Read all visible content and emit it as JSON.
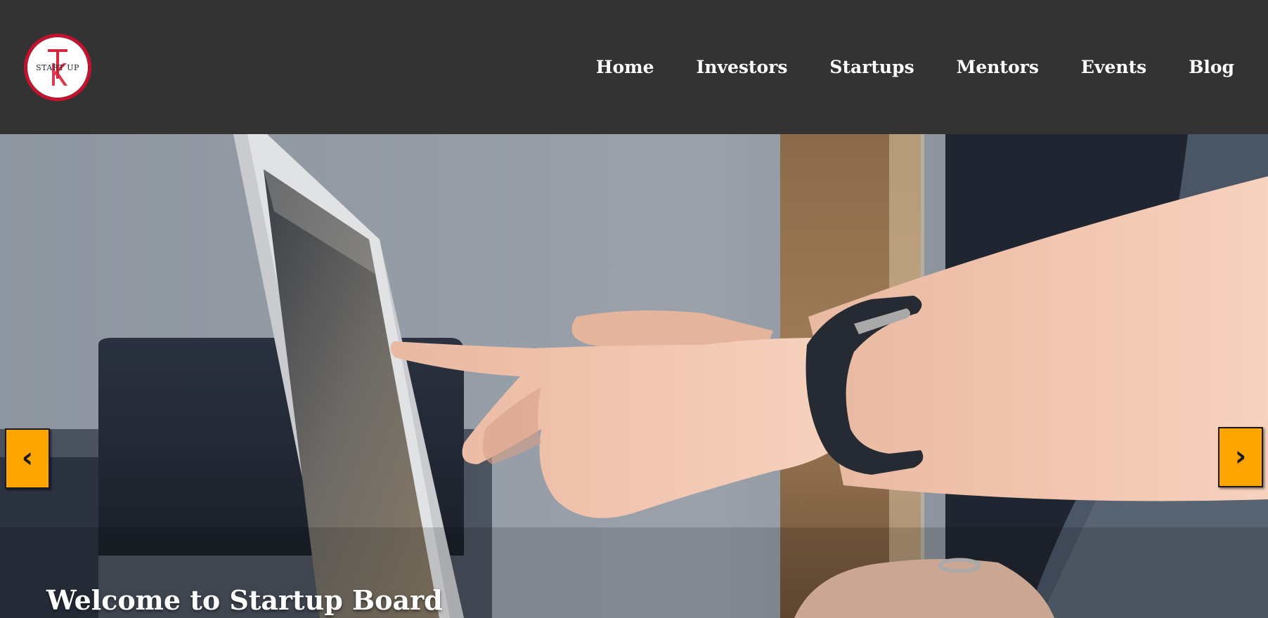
{
  "logo": {
    "letters": "TK",
    "text": "START UP",
    "colors": {
      "ring": "#c8102e",
      "letters": "#d7263d",
      "text": "#222222"
    }
  },
  "nav": {
    "items": [
      {
        "label": "Home"
      },
      {
        "label": "Investors"
      },
      {
        "label": "Startups"
      },
      {
        "label": "Mentors"
      },
      {
        "label": "Events"
      },
      {
        "label": "Blog"
      }
    ]
  },
  "hero": {
    "title": "Welcome to Startup Board",
    "prev_label": "‹",
    "next_label": "›",
    "image_description_icon": "photo-laptop-hand-icon"
  },
  "colors": {
    "header_bg": "#333333",
    "nav_text": "#ffffff",
    "arrow_bg": "#ffa500"
  }
}
